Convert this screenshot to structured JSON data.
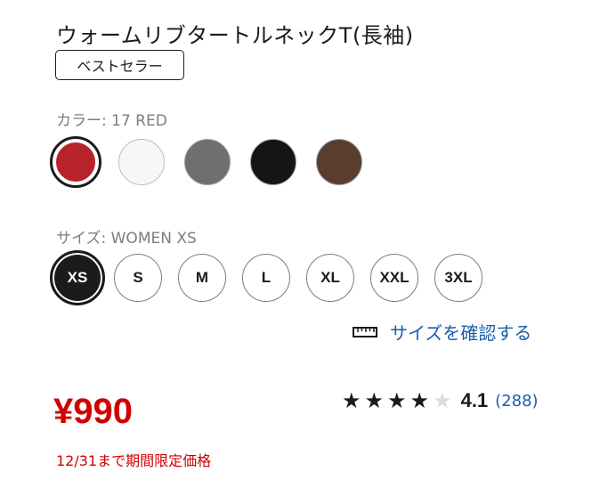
{
  "product": {
    "title": "ウォームリブタートルネックT(長袖)",
    "badge": "ベストセラー"
  },
  "color": {
    "label_prefix": "カラー: ",
    "selected_value": "17 RED",
    "options": [
      {
        "name": "red",
        "hex": "#b8222a",
        "selected": true
      },
      {
        "name": "white",
        "hex": "#f7f7f7",
        "selected": false
      },
      {
        "name": "gray",
        "hex": "#6f6f6f",
        "selected": false
      },
      {
        "name": "black",
        "hex": "#151515",
        "selected": false
      },
      {
        "name": "brown",
        "hex": "#5a3d2e",
        "selected": false
      }
    ]
  },
  "size": {
    "label_prefix": "サイズ: ",
    "selected_value": "WOMEN XS",
    "options": [
      {
        "label": "XS",
        "selected": true
      },
      {
        "label": "S",
        "selected": false
      },
      {
        "label": "M",
        "selected": false
      },
      {
        "label": "L",
        "selected": false
      },
      {
        "label": "XL",
        "selected": false
      },
      {
        "label": "XXL",
        "selected": false
      },
      {
        "label": "3XL",
        "selected": false
      }
    ],
    "guide_label": "サイズを確認する",
    "guide_icon": "ruler-icon"
  },
  "pricing": {
    "price": "¥990",
    "promo": "12/31まで期間限定価格"
  },
  "rating": {
    "value": "4.1",
    "stars_filled": 4,
    "stars_total": 5,
    "review_count": "(288)"
  },
  "colors": {
    "price_red": "#d20000",
    "link_blue": "#1a5dab"
  }
}
